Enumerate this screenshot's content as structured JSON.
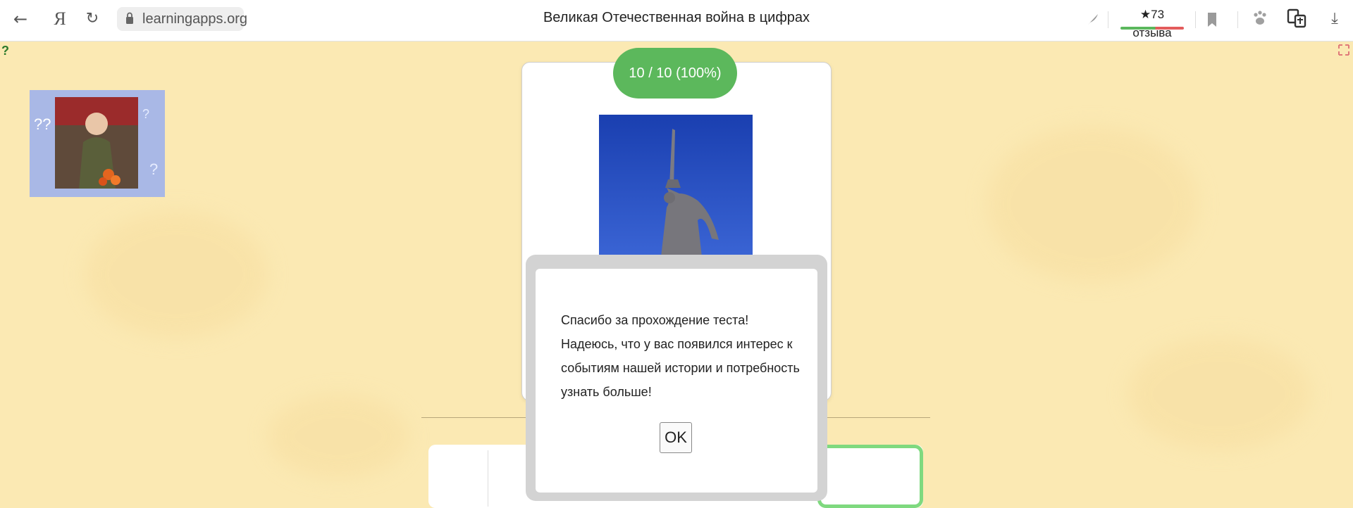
{
  "browser": {
    "back_icon": "arrow-left-icon",
    "yandex_logo": "Я",
    "reload_icon": "reload-icon",
    "url": "learningapps.org",
    "page_title": "Великая Отечественная война в цифрах",
    "reviews": "★73 отзыва",
    "icons": [
      "feather-icon",
      "bookmark-icon",
      "paw-icon",
      "translate-icon",
      "download-icon"
    ]
  },
  "quiz": {
    "score": "10 / 10 (100%)"
  },
  "dialog": {
    "message": "Спасибо за прохождение теста! Надеюсь, что у вас появился интерес к событиям нашей истории и потребность узнать больше!",
    "ok_label": "OK"
  },
  "colors": {
    "background": "#fbe9b3",
    "score_green": "#5cb85c",
    "card_border_green": "#7fd97f"
  }
}
